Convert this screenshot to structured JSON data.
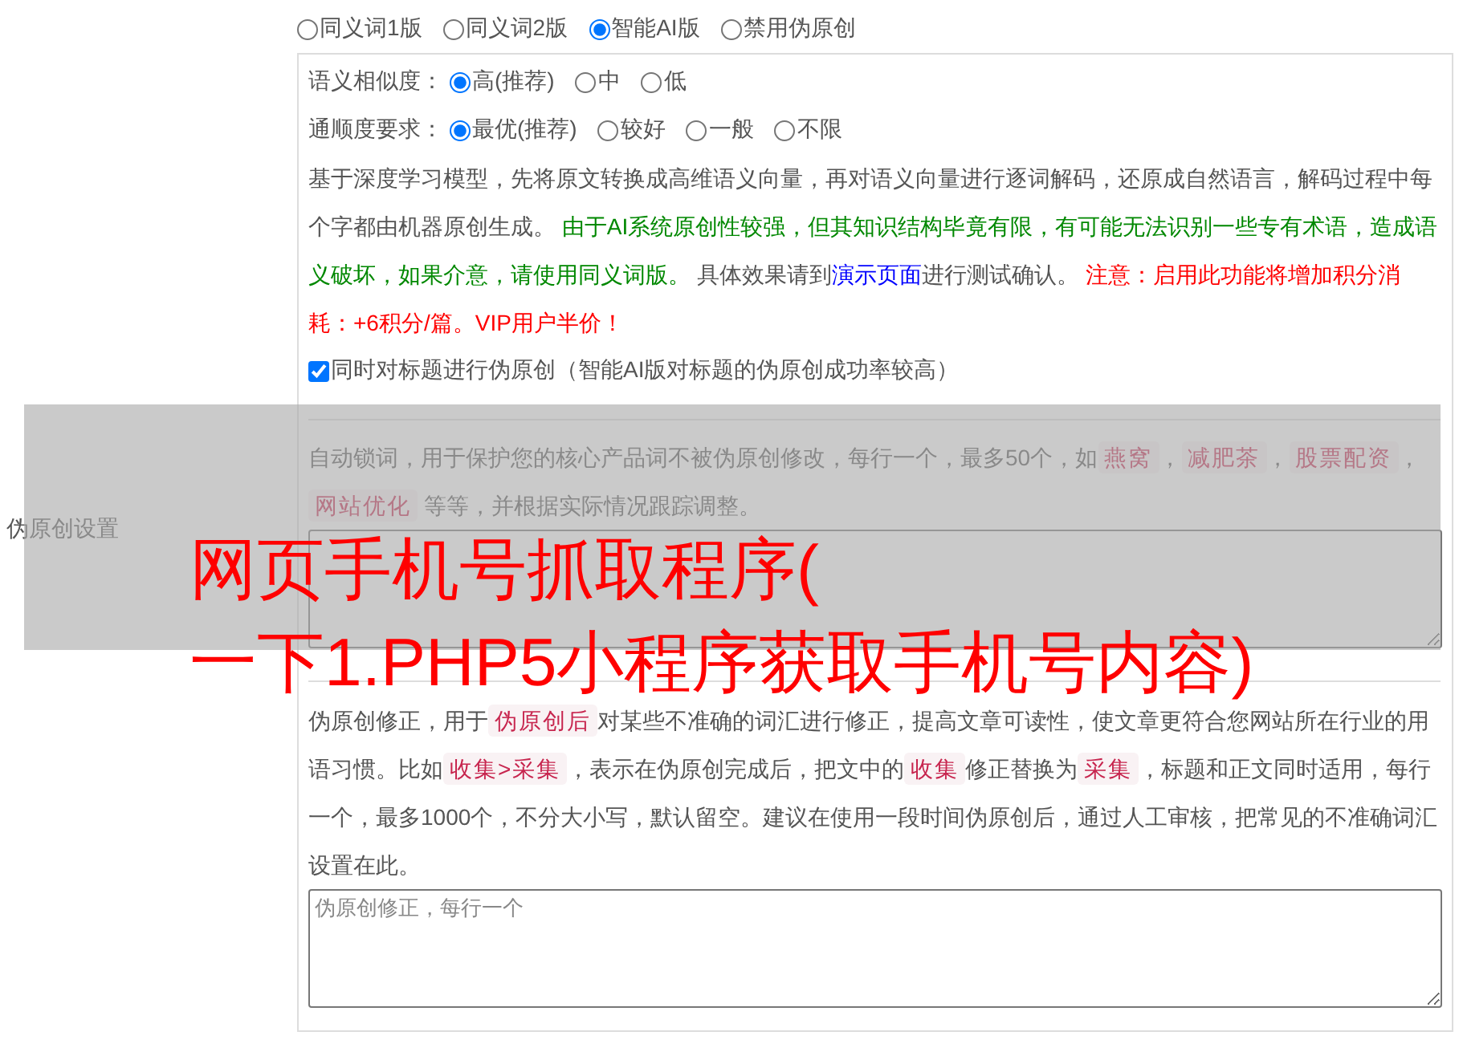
{
  "mode_options": [
    {
      "label": "同义词1版",
      "selected": false
    },
    {
      "label": "同义词2版",
      "selected": false
    },
    {
      "label": "智能AI版",
      "selected": true
    },
    {
      "label": "禁用伪原创",
      "selected": false
    }
  ],
  "similarity": {
    "label": "语义相似度：",
    "options": [
      {
        "label": "高(推荐)",
        "selected": true
      },
      {
        "label": "中",
        "selected": false
      },
      {
        "label": "低",
        "selected": false
      }
    ]
  },
  "fluency": {
    "label": "通顺度要求：",
    "options": [
      {
        "label": "最优(推荐)",
        "selected": true
      },
      {
        "label": "较好",
        "selected": false
      },
      {
        "label": "一般",
        "selected": false
      },
      {
        "label": "不限",
        "selected": false
      }
    ]
  },
  "ai_description": [
    {
      "kind": "text",
      "text": "基于深度学习模型，先将原文转换成高维语义向量，再对语义向量进行逐词解码，还原成自然语言，解码过程中每个字都由机器原创生成。 "
    },
    {
      "kind": "green",
      "text": "由于AI系统原创性较强，但其知识结构毕竟有限，有可能无法识别一些专有术语，造成语义破坏，如果介意，请使用同义词版。"
    },
    {
      "kind": "text",
      "text": " 具体效果请到"
    },
    {
      "kind": "link",
      "text": "演示页面"
    },
    {
      "kind": "text",
      "text": "进行测试确认。 "
    },
    {
      "kind": "warn",
      "text": "注意：启用此功能将增加积分消耗：+6积分/篇。VIP用户半价！"
    }
  ],
  "title_checkbox": {
    "label": "同时对标题进行伪原创（智能AI版对标题的伪原创成功率较高）",
    "checked": true
  },
  "section_label": "伪原创设置",
  "lock_words": {
    "description": [
      {
        "kind": "text",
        "text": "自动锁词，用于保护您的核心产品词不被伪原创修改，每行一个，最多50个，如"
      },
      {
        "kind": "code",
        "text": "燕窝"
      },
      {
        "kind": "text",
        "text": "，"
      },
      {
        "kind": "code",
        "text": "减肥茶"
      },
      {
        "kind": "text",
        "text": "，"
      },
      {
        "kind": "code",
        "text": "股票配资"
      },
      {
        "kind": "text",
        "text": "，"
      },
      {
        "kind": "code",
        "text": "网站优化"
      },
      {
        "kind": "text",
        "text": " 等等，并根据实际情况跟踪调整。"
      }
    ]
  },
  "correction": {
    "description": [
      {
        "kind": "text",
        "text": "伪原创修正，用于"
      },
      {
        "kind": "code",
        "text": "伪原创后"
      },
      {
        "kind": "text",
        "text": "对某些不准确的词汇进行修正，提高文章可读性，使文章更符合您网站所在行业的用语习惯。比如"
      },
      {
        "kind": "code",
        "text": "收集>采集"
      },
      {
        "kind": "text",
        "text": "，表示在伪原创完成后，把文中的"
      },
      {
        "kind": "code",
        "text": "收集"
      },
      {
        "kind": "text",
        "text": "修正替换为"
      },
      {
        "kind": "code",
        "text": "采集"
      },
      {
        "kind": "text",
        "text": "，标题和正文同时适用，每行一个，最多1000个，不分大小写，默认留空。建议在使用一段时间伪原创后，通过人工审核，把常见的不准确词汇设置在此。"
      }
    ],
    "placeholder": "伪原创修正，每行一个"
  },
  "banner": {
    "lines": [
      "网页手机号抓取程序(",
      "一下1.PHP5小程序获取手机号内容)"
    ]
  }
}
